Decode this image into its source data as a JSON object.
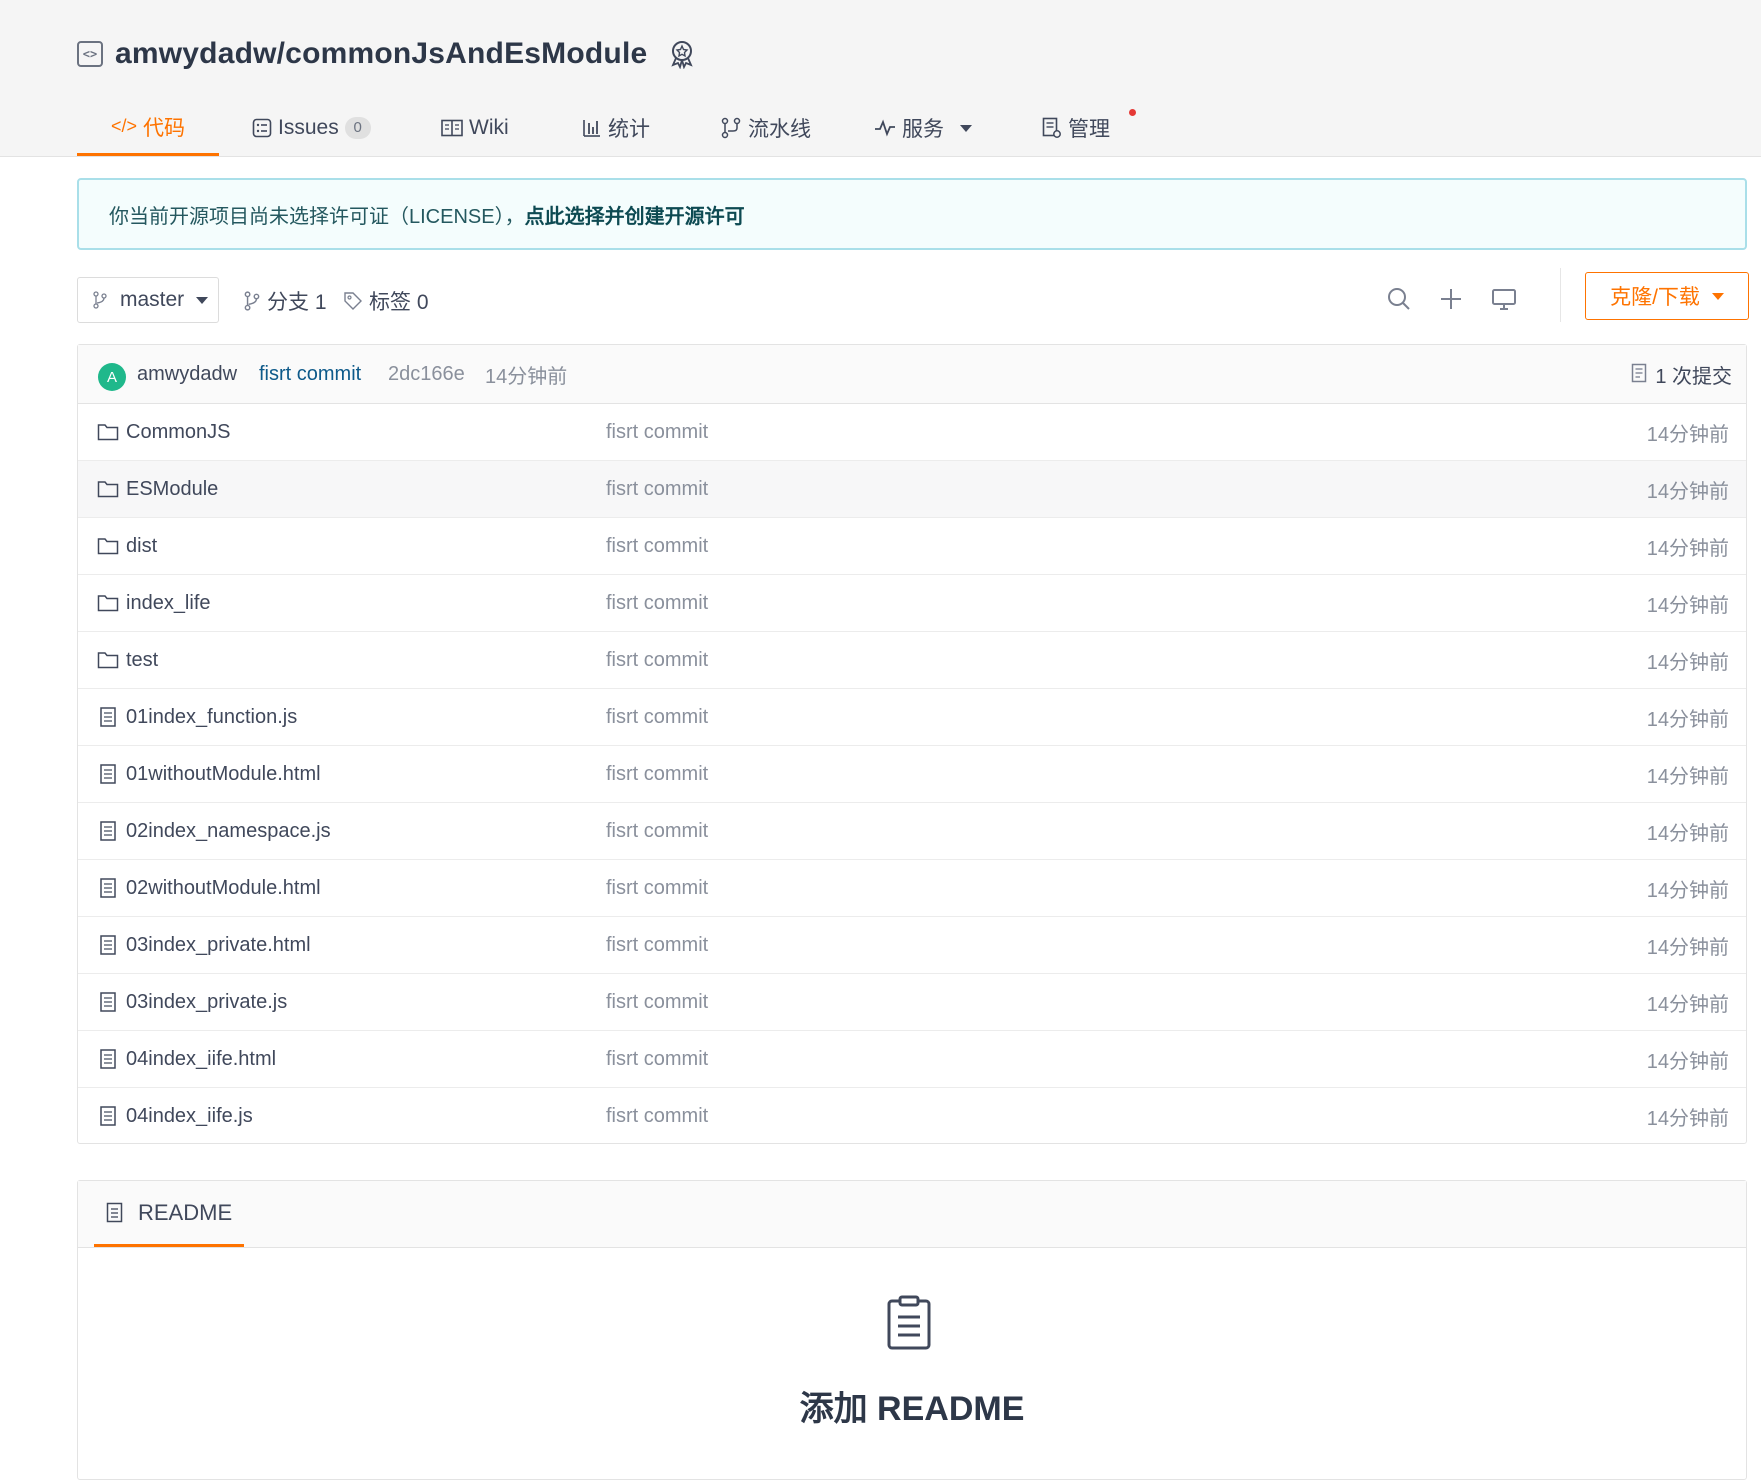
{
  "repo": {
    "full_name": "amwydadw/commonJsAndEsModule"
  },
  "tabs": [
    {
      "label": "代码",
      "icon": "code-icon",
      "active": true
    },
    {
      "label": "Issues",
      "icon": "issues-icon",
      "count": "0"
    },
    {
      "label": "Wiki",
      "icon": "wiki-icon"
    },
    {
      "label": "统计",
      "icon": "chart-icon"
    },
    {
      "label": "流水线",
      "icon": "pipeline-icon"
    },
    {
      "label": "服务",
      "icon": "pulse-icon"
    },
    {
      "label": "管理",
      "icon": "manage-icon",
      "has_dot": true
    }
  ],
  "license_notice": {
    "text": "你当前开源项目尚未选择许可证（LICENSE），",
    "link": "点此选择并创建开源许可"
  },
  "branch": {
    "current": "master",
    "branches_label": "分支 1",
    "tags_label": "标签 0"
  },
  "clone_button": "克隆/下载",
  "last_commit": {
    "avatar_letter": "A",
    "author": "amwydadw",
    "message": "fisrt commit",
    "sha": "2dc166e",
    "time": "14分钟前",
    "count_label": "1 次提交"
  },
  "files": [
    {
      "type": "folder",
      "name": "CommonJS",
      "message": "fisrt commit",
      "time": "14分钟前"
    },
    {
      "type": "folder",
      "name": "ESModule",
      "message": "fisrt commit",
      "time": "14分钟前"
    },
    {
      "type": "folder",
      "name": "dist",
      "message": "fisrt commit",
      "time": "14分钟前"
    },
    {
      "type": "folder",
      "name": "index_life",
      "message": "fisrt commit",
      "time": "14分钟前"
    },
    {
      "type": "folder",
      "name": "test",
      "message": "fisrt commit",
      "time": "14分钟前"
    },
    {
      "type": "file",
      "name": "01index_function.js",
      "message": "fisrt commit",
      "time": "14分钟前"
    },
    {
      "type": "file",
      "name": "01withoutModule.html",
      "message": "fisrt commit",
      "time": "14分钟前"
    },
    {
      "type": "file",
      "name": "02index_namespace.js",
      "message": "fisrt commit",
      "time": "14分钟前"
    },
    {
      "type": "file",
      "name": "02withoutModule.html",
      "message": "fisrt commit",
      "time": "14分钟前"
    },
    {
      "type": "file",
      "name": "03index_private.html",
      "message": "fisrt commit",
      "time": "14分钟前"
    },
    {
      "type": "file",
      "name": "03index_private.js",
      "message": "fisrt commit",
      "time": "14分钟前"
    },
    {
      "type": "file",
      "name": "04index_iife.html",
      "message": "fisrt commit",
      "time": "14分钟前"
    },
    {
      "type": "file",
      "name": "04index_iife.js",
      "message": "fisrt commit",
      "time": "14分钟前"
    }
  ],
  "readme": {
    "tab_label": "README",
    "add_label": "添加 README"
  },
  "colors": {
    "accent": "#fe7300",
    "link": "#0e5a8a",
    "license_border": "#a9dfe9"
  }
}
